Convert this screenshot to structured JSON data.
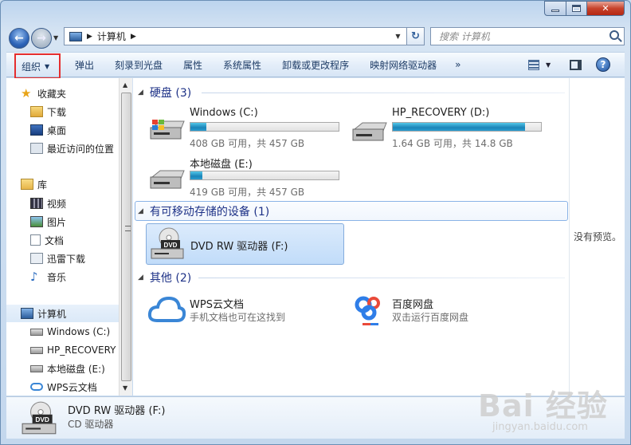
{
  "window": {
    "address_crumb": "计算机",
    "search_placeholder": "搜索 计算机"
  },
  "toolbar": {
    "organize_label": "组织",
    "items": [
      "弹出",
      "刻录到光盘",
      "属性",
      "系统属性",
      "卸载或更改程序",
      "映射网络驱动器"
    ],
    "overflow": "»"
  },
  "sidebar": {
    "favorites_header": "收藏夹",
    "favorites": [
      "下载",
      "桌面",
      "最近访问的位置"
    ],
    "libraries_header": "库",
    "libraries": [
      "视频",
      "图片",
      "文档",
      "迅雷下载",
      "音乐"
    ],
    "computer_header": "计算机",
    "computer_items": [
      "Windows (C:)",
      "HP_RECOVERY",
      "本地磁盘 (E:)",
      "WPS云文档"
    ]
  },
  "main": {
    "hdd_header": "硬盘 (3)",
    "drives": [
      {
        "name": "Windows (C:)",
        "info": "408 GB 可用，共 457 GB",
        "used_fraction": 0.11
      },
      {
        "name": "HP_RECOVERY (D:)",
        "info": "1.64 GB 可用，共 14.8 GB",
        "used_fraction": 0.89
      },
      {
        "name": "本地磁盘 (E:)",
        "info": "419 GB 可用，共 457 GB",
        "used_fraction": 0.08
      }
    ],
    "removable_header": "有可移动存储的设备 (1)",
    "dvd": {
      "name": "DVD RW 驱动器 (F:)",
      "icon_label": "DVD"
    },
    "other_header": "其他 (2)",
    "others": [
      {
        "name": "WPS云文档",
        "sub": "手机文档也可在这找到"
      },
      {
        "name": "百度网盘",
        "sub": "双击运行百度网盘"
      }
    ]
  },
  "preview": {
    "text": "没有预览。"
  },
  "details": {
    "title": "DVD RW 驱动器 (F:)",
    "subtitle": "CD 驱动器",
    "icon_label": "DVD"
  },
  "watermark": {
    "logo": "Bai 经验",
    "url": "jingyan.baidu.com"
  }
}
